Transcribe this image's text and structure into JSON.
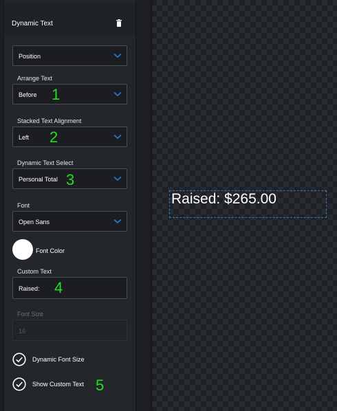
{
  "panel": {
    "title": "Dynamic Text",
    "position_select": "Position",
    "arrange_text": {
      "label": "Arrange Text",
      "value": "Before"
    },
    "stacked_alignment": {
      "label": "Stacked Text Alignment",
      "value": "Left"
    },
    "dynamic_text_select": {
      "label": "Dynamic Text Select",
      "value": "Personal Total"
    },
    "font": {
      "label": "Font",
      "value": "Open Sans"
    },
    "font_color": {
      "label": "Font Color",
      "color": "#ffffff"
    },
    "custom_text": {
      "label": "Custom Text",
      "value": "Raised:"
    },
    "font_size": {
      "label": "Font Size",
      "value": "16"
    },
    "dynamic_font_size": {
      "label": "Dynamic Font Size",
      "checked": true
    },
    "show_custom_text": {
      "label": "Show Custom Text",
      "checked": true
    }
  },
  "annotations": [
    "1",
    "2",
    "3",
    "4",
    "5"
  ],
  "preview": {
    "text": "Raised: $265.00"
  },
  "colors": {
    "annotation": "#22e01f",
    "accent": "#2a7bd6",
    "panel_bg": "#23262b",
    "field_border": "#4b5057"
  }
}
